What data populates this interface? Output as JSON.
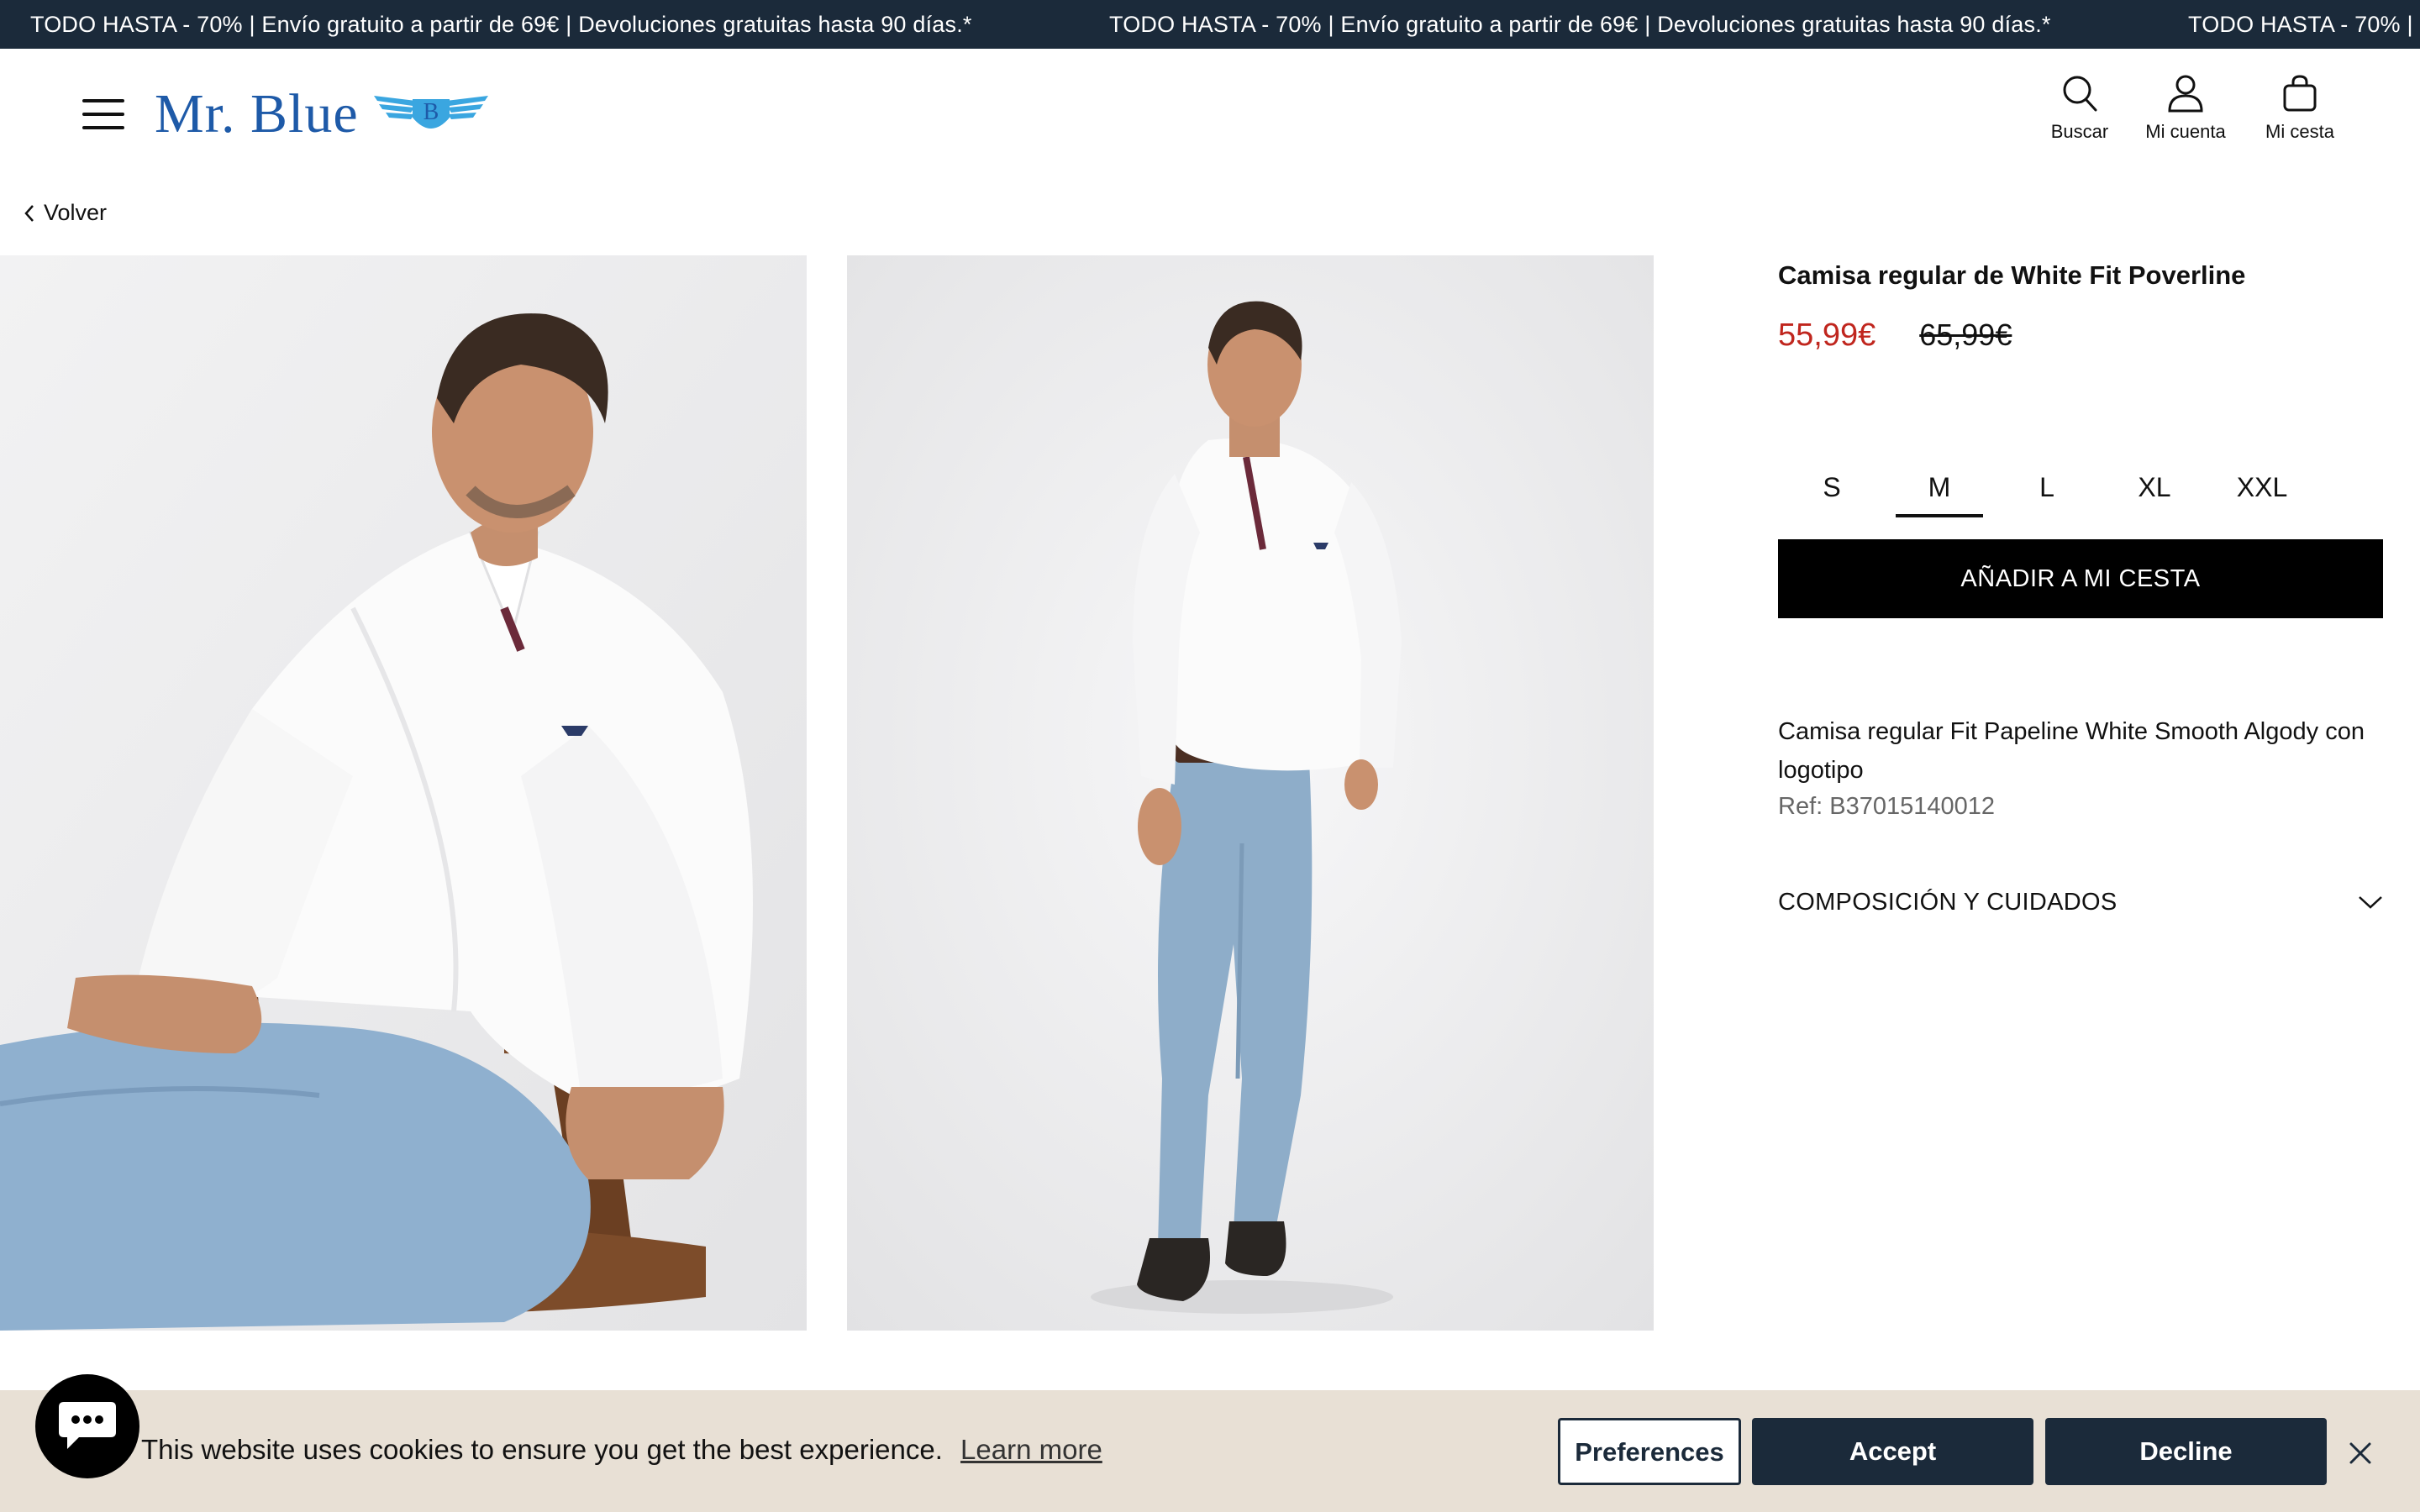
{
  "announcement": {
    "text": "TODO HASTA - 70% | Envío gratuito a partir de 69€ | Devoluciones gratuitas hasta 90 días.*",
    "text_truncated": "TODO HASTA - 70% | E"
  },
  "header": {
    "logo_text": "Mr. Blue",
    "logo_badge": "B",
    "actions": [
      {
        "label": "Buscar",
        "icon": "search-icon"
      },
      {
        "label": "Mi cuenta",
        "icon": "user-icon"
      },
      {
        "label": "Mi cesta",
        "icon": "bag-icon"
      }
    ]
  },
  "nav": {
    "back_label": "Volver"
  },
  "product": {
    "title": "Camisa regular de White Fit Poverline",
    "price_current": "55,99€",
    "price_original": "65,99€",
    "sizes": [
      "S",
      "M",
      "L",
      "XL",
      "XXL"
    ],
    "selected_size": "M",
    "add_to_cart": "AÑADIR A MI CESTA",
    "description": "Camisa regular Fit Papeline White Smooth Algody con logotipo",
    "reference": "Ref: B37015140012",
    "accordion_title": "COMPOSICIÓN Y CUIDADOS",
    "colors": {
      "sale": "#c0261e",
      "brand": "#1e5aa8",
      "dark": "#1b2a3a"
    }
  },
  "cookie": {
    "message": "This website uses cookies to ensure you get the best experience.",
    "learn_more": "Learn more",
    "preferences": "Preferences",
    "accept": "Accept",
    "decline": "Decline"
  }
}
